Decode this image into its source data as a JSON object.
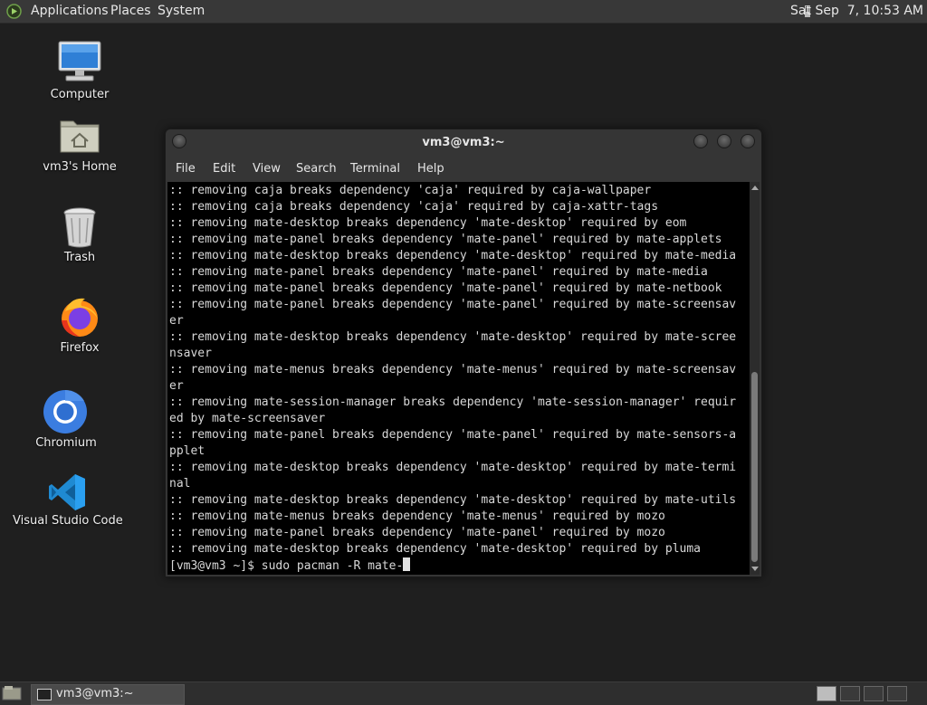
{
  "top_panel": {
    "menus": [
      "Applications",
      "Places",
      "System"
    ],
    "clock": "Sat Sep  7, 10:53 AM"
  },
  "desktop_icons": [
    {
      "label": "Computer",
      "icon": "computer-icon"
    },
    {
      "label": "vm3's Home",
      "icon": "home-folder-icon"
    },
    {
      "label": "Trash",
      "icon": "trash-icon"
    },
    {
      "label": "Firefox",
      "icon": "firefox-icon"
    },
    {
      "label": "Chromium",
      "icon": "chromium-icon"
    },
    {
      "label": "Visual Studio Code",
      "icon": "vscode-icon"
    }
  ],
  "window": {
    "title": "vm3@vm3:~",
    "menu": [
      "File",
      "Edit",
      "View",
      "Search",
      "Terminal",
      "Help"
    ]
  },
  "terminal": {
    "lines": [
      ":: removing caja breaks dependency 'caja' required by caja-wallpaper",
      ":: removing caja breaks dependency 'caja' required by caja-xattr-tags",
      ":: removing mate-desktop breaks dependency 'mate-desktop' required by eom",
      ":: removing mate-panel breaks dependency 'mate-panel' required by mate-applets",
      ":: removing mate-desktop breaks dependency 'mate-desktop' required by mate-media",
      ":: removing mate-panel breaks dependency 'mate-panel' required by mate-media",
      ":: removing mate-panel breaks dependency 'mate-panel' required by mate-netbook",
      ":: removing mate-panel breaks dependency 'mate-panel' required by mate-screensav",
      "er",
      ":: removing mate-desktop breaks dependency 'mate-desktop' required by mate-scree",
      "nsaver",
      ":: removing mate-menus breaks dependency 'mate-menus' required by mate-screensav",
      "er",
      ":: removing mate-session-manager breaks dependency 'mate-session-manager' requir",
      "ed by mate-screensaver",
      ":: removing mate-panel breaks dependency 'mate-panel' required by mate-sensors-a",
      "pplet",
      ":: removing mate-desktop breaks dependency 'mate-desktop' required by mate-termi",
      "nal",
      ":: removing mate-desktop breaks dependency 'mate-desktop' required by mate-utils",
      ":: removing mate-menus breaks dependency 'mate-menus' required by mozo",
      ":: removing mate-panel breaks dependency 'mate-panel' required by mozo",
      ":: removing mate-desktop breaks dependency 'mate-desktop' required by pluma"
    ],
    "prompt": "[vm3@vm3 ~]$ ",
    "command": "sudo pacman -R mate-"
  },
  "taskbar": {
    "task_label": "vm3@vm3:~"
  }
}
